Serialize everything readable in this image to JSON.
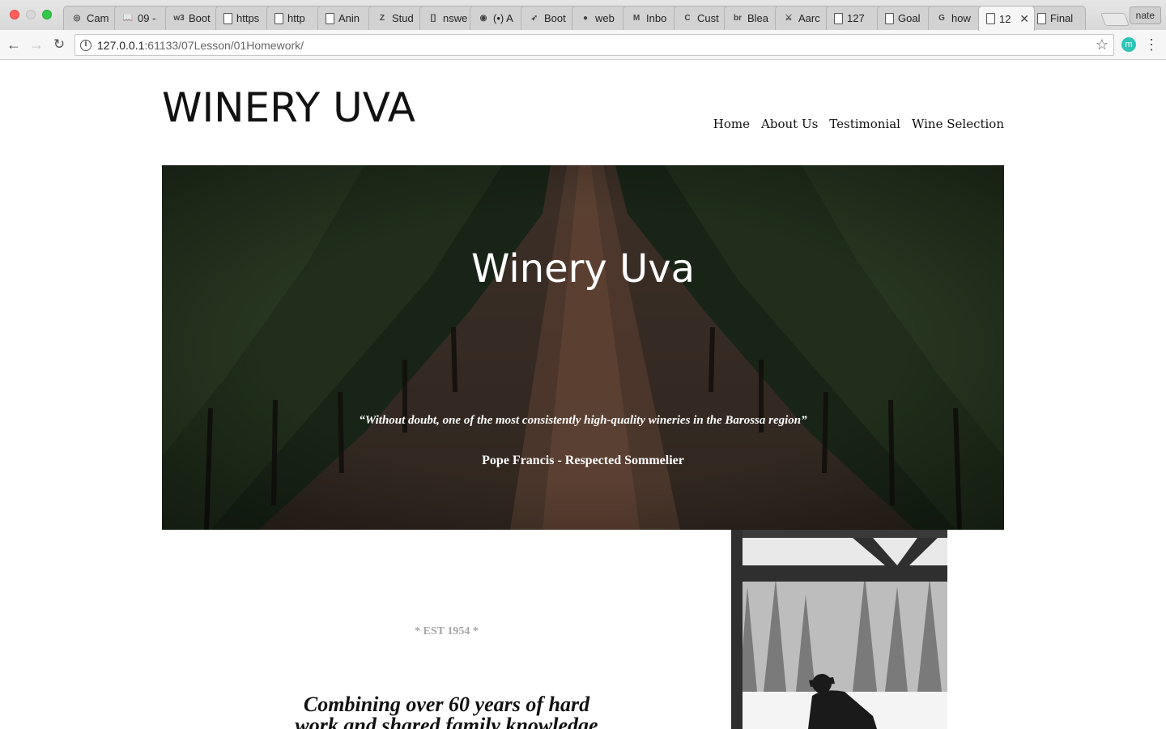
{
  "browser": {
    "tabs": [
      {
        "label": "Cam",
        "icon": "app-icon",
        "glyph": "◎"
      },
      {
        "label": "09 -",
        "icon": "book-icon",
        "glyph": "📖"
      },
      {
        "label": "Boot",
        "icon": "w3-icon",
        "glyph": "w3"
      },
      {
        "label": "https",
        "icon": "document-icon",
        "glyph": ""
      },
      {
        "label": "http",
        "icon": "document-icon",
        "glyph": ""
      },
      {
        "label": "Anin",
        "icon": "document-icon",
        "glyph": ""
      },
      {
        "label": "Stud",
        "icon": "z-icon",
        "glyph": "Z"
      },
      {
        "label": "nswe",
        "icon": "code-icon",
        "glyph": "[]"
      },
      {
        "label": "(•) A",
        "icon": "chrome-icon",
        "glyph": "◉"
      },
      {
        "label": "Boot",
        "icon": "bird-icon",
        "glyph": "➶"
      },
      {
        "label": "web",
        "icon": "github-icon",
        "glyph": "●"
      },
      {
        "label": "Inbo",
        "icon": "gmail-icon",
        "glyph": "M"
      },
      {
        "label": "Cust",
        "icon": "shield-icon",
        "glyph": "C"
      },
      {
        "label": "Blea",
        "icon": "br-icon",
        "glyph": "br"
      },
      {
        "label": "Aarc",
        "icon": "sword-icon",
        "glyph": "⚔"
      },
      {
        "label": "127",
        "icon": "document-icon",
        "glyph": ""
      },
      {
        "label": "Goal",
        "icon": "document-icon",
        "glyph": ""
      },
      {
        "label": "how",
        "icon": "google-icon",
        "glyph": "G"
      },
      {
        "label": "12",
        "icon": "document-icon",
        "glyph": "",
        "active": true
      },
      {
        "label": "Final",
        "icon": "document-icon",
        "glyph": ""
      }
    ],
    "profile": "nate",
    "url_host": "127.0.0.1",
    "url_rest": ":61133/07Lesson/01Homework/",
    "extension_letter": "m"
  },
  "site": {
    "title": "WINERY UVA",
    "nav": [
      "Home",
      "About Us",
      "Testimonial",
      "Wine Selection"
    ],
    "hero": {
      "title": "Winery Uva",
      "quote": "“Without doubt, one of the most consistently high-quality wineries in the Barossa region”",
      "author": "Pope Francis - Respected Sommelier"
    },
    "est": "* EST 1954 *",
    "tagline_line1": "Combining over 60 years of hard",
    "tagline_line2": "work and shared family knowledge"
  },
  "colors": {
    "hero_overlay": "#2b2a22",
    "vine_leaf": "#1f2e1c",
    "path": "#6b4634"
  }
}
